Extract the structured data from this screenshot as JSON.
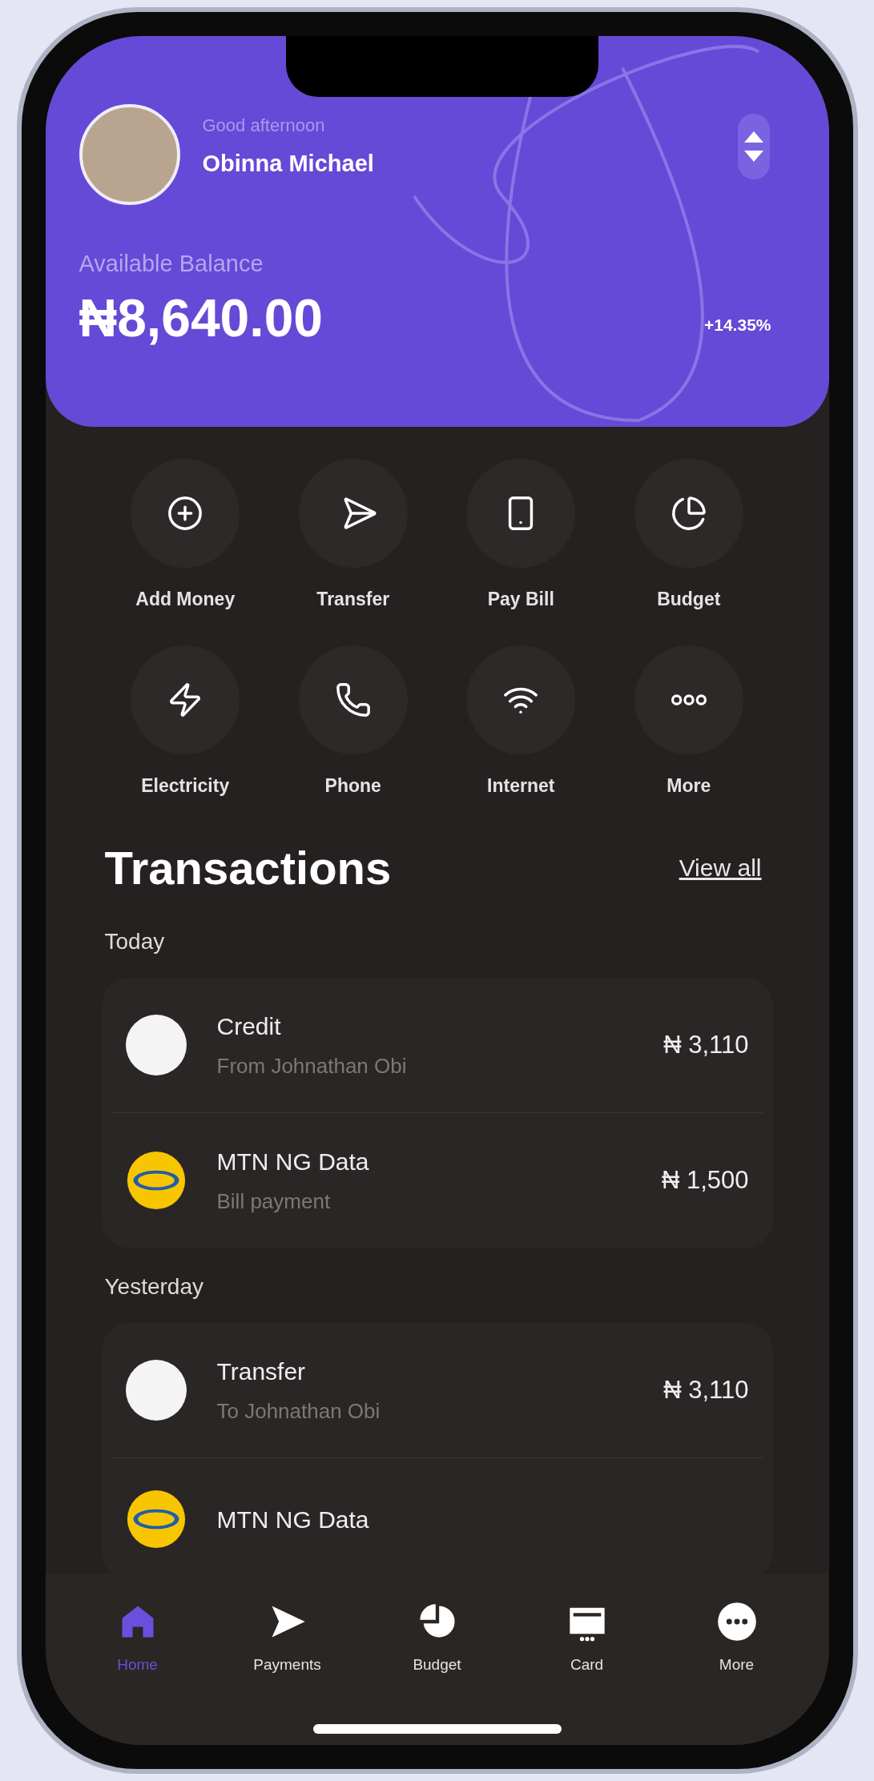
{
  "header": {
    "greeting": "Good afternoon",
    "name": "Obinna Michael",
    "balance_label": "Available Balance",
    "balance": "₦8,640.00",
    "change": "+14.35%"
  },
  "actions": [
    {
      "kind": "add",
      "label": "Add Money"
    },
    {
      "kind": "transfer",
      "label": "Transfer"
    },
    {
      "kind": "bill",
      "label": "Pay Bill"
    },
    {
      "kind": "budget",
      "label": "Budget"
    },
    {
      "kind": "electricity",
      "label": "Electricity"
    },
    {
      "kind": "phone",
      "label": "Phone"
    },
    {
      "kind": "internet",
      "label": "Internet"
    },
    {
      "kind": "more",
      "label": "More"
    }
  ],
  "transactions": {
    "title": "Transactions",
    "view_all": "View all",
    "groups": [
      {
        "label": "Today",
        "items": [
          {
            "kind": "person",
            "title": "Credit",
            "subtitle": "From Johnathan Obi",
            "amount": "₦ 3,110"
          },
          {
            "kind": "telecom",
            "title": "MTN NG Data",
            "subtitle": "Bill payment",
            "amount": "₦ 1,500"
          }
        ]
      },
      {
        "label": "Yesterday",
        "items": [
          {
            "kind": "person",
            "title": "Transfer",
            "subtitle": "To Johnathan Obi",
            "amount": "₦ 3,110"
          },
          {
            "kind": "telecom",
            "title": "MTN NG Data"
          }
        ]
      }
    ]
  },
  "nav": [
    {
      "kind": "home",
      "label": "Home",
      "selected": true
    },
    {
      "kind": "payments",
      "label": "Payments",
      "selected": false
    },
    {
      "kind": "budget",
      "label": "Budget",
      "selected": false
    },
    {
      "kind": "card",
      "label": "Card",
      "selected": false
    },
    {
      "kind": "more",
      "label": "More",
      "selected": false
    }
  ]
}
